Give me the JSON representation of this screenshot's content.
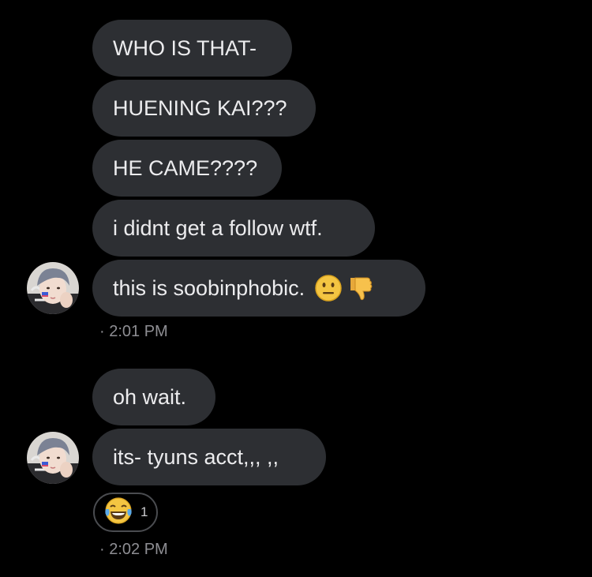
{
  "messages": [
    {
      "text": "WHO IS THAT-"
    },
    {
      "text": "HUENING KAI???"
    },
    {
      "text": "HE CAME????"
    },
    {
      "text": "i didnt get a follow wtf."
    },
    {
      "text": "this is soobinphobic.",
      "emojis": [
        "neutral-face-emoji",
        "thumbs-down-emoji"
      ]
    },
    {
      "text": "oh wait."
    },
    {
      "text": "its- tyuns acct,,, ,,"
    }
  ],
  "timestamps": [
    "· 2:01 PM",
    "· 2:02 PM"
  ],
  "reaction": {
    "emoji": "face-with-tears-of-joy-emoji",
    "count": "1"
  },
  "colors": {
    "background": "#000000",
    "bubble": "#2d2f33",
    "text": "#ececee",
    "timestamp": "#8e8e93"
  }
}
